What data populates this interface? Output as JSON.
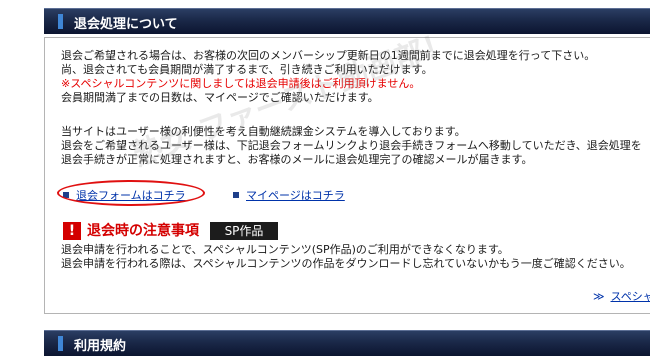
{
  "header": {
    "title": "退会処理について"
  },
  "paragraph1": {
    "line1": "退会ご希望される場合は、お客様の次回のメンバーシップ更新日の1週間前までに退会処理を行って下さい。",
    "line2": "尚、退会されても会員期間が満了するまで、引き続きご利用いただけます。",
    "line3_red": "※スペシャルコンテンツに関しましては退会申請後はご利用頂けません。",
    "line4": "会員期間満了までの日数は、マイページでご確認いただけます。"
  },
  "paragraph2": {
    "line1": "当サイトはユーザー様の利便性を考え自動継続課金システムを導入しております。",
    "line2": "退会をご希望されるユーザー様は、下記退会フォームリンクより退会手続きフォームへ移動していただき、退会処理を",
    "line3": "退会手続きが正常に処理されますと、お客様のメールに退会処理完了の確認メールが届きます。"
  },
  "links": {
    "withdraw_form": "退会フォームはコチラ",
    "mypage": "マイページはコチラ"
  },
  "notice": {
    "icon": "!",
    "title": "退会時の注意事項",
    "badge": "SP作品",
    "line1": "退会申請を行われることで、スペシャルコンテンツ(SP作品)のご利用ができなくなります。",
    "line2": "退会申請を行われる際は、スペシャルコンテンツの作品をダウンロードし忘れていないかもう一度ご確認ください。"
  },
  "more_link": {
    "arrow": "≫",
    "label": "スペシャ"
  },
  "header2": {
    "title": "利用規約"
  },
  "watermark": "熟女 ファースト動画部！",
  "colors": {
    "header_bg": "#1a2848",
    "accent_bar": "#3f86d6",
    "red": "#e60000",
    "link": "#0033aa"
  }
}
